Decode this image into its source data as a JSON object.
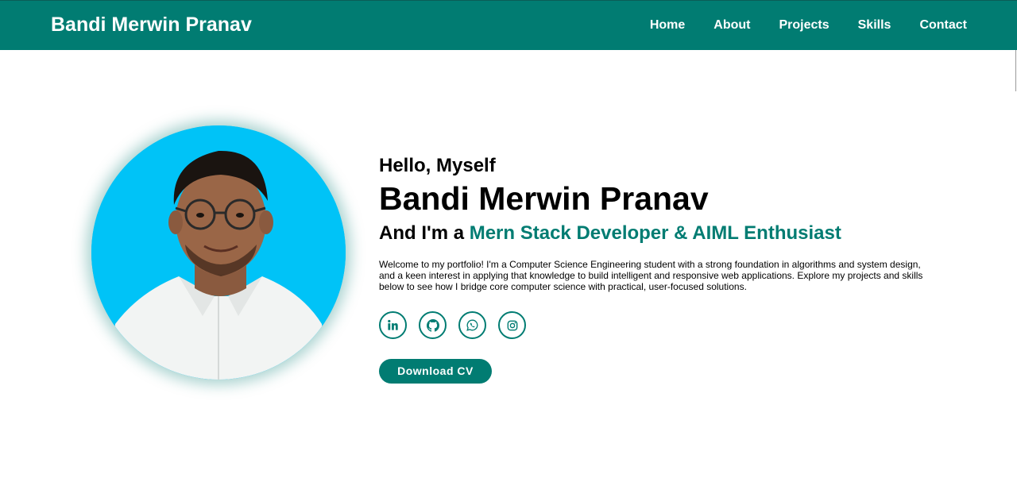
{
  "header": {
    "brand": "Bandi Merwin Pranav",
    "nav": [
      "Home",
      "About",
      "Projects",
      "Skills",
      "Contact"
    ]
  },
  "hero": {
    "greeting": "Hello, Myself",
    "name": "Bandi Merwin Pranav",
    "role_prefix": "And I'm a ",
    "role_highlight": "Mern Stack Developer & AIML Enthusiast",
    "bio": "Welcome to my portfolio! I'm a Computer Science Engineering student with a strong foundation in algorithms and system design, and a keen interest in applying that knowledge to build intelligent and responsive web applications. Explore my projects and skills below to see how I bridge core computer science with practical, user-focused solutions.",
    "cv_button": "Download CV",
    "socials": [
      "linkedin-icon",
      "github-icon",
      "whatsapp-icon",
      "instagram-icon"
    ]
  },
  "colors": {
    "accent": "#017c72",
    "photo_bg": "#00c3f7",
    "text": "#000000"
  }
}
